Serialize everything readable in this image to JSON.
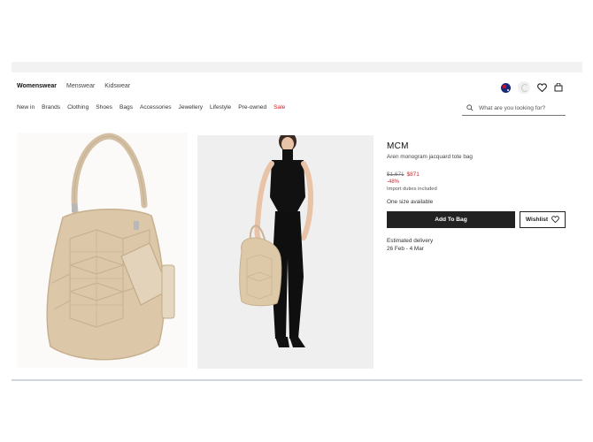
{
  "nav": {
    "gender_tabs": [
      "Womenswear",
      "Menswear",
      "Kidswear"
    ],
    "categories": [
      "New in",
      "Brands",
      "Clothing",
      "Shoes",
      "Bags",
      "Accessories",
      "Jewellery",
      "Lifestyle",
      "Pre-owned",
      "Sale"
    ]
  },
  "search": {
    "placeholder": "What are you looking for?"
  },
  "product": {
    "brand": "MCM",
    "name": "Aren monogram jacquard tote bag",
    "old_price": "$1,671",
    "new_price": "$871",
    "discount": "-48%",
    "duties": "Import duties included",
    "size_info": "One size available",
    "add_to_bag": "Add To Bag",
    "wishlist": "Wishlist",
    "delivery_label": "Estimated delivery",
    "delivery_dates": "26 Feb - 4 Mar"
  },
  "icons": [
    "australia-flag-icon",
    "loading-icon",
    "heart-icon",
    "bag-icon",
    "search-icon",
    "heart-outline-icon"
  ],
  "colors": {
    "sale": "#d3212c",
    "button": "#222222",
    "bag": "#d9c4a6"
  }
}
